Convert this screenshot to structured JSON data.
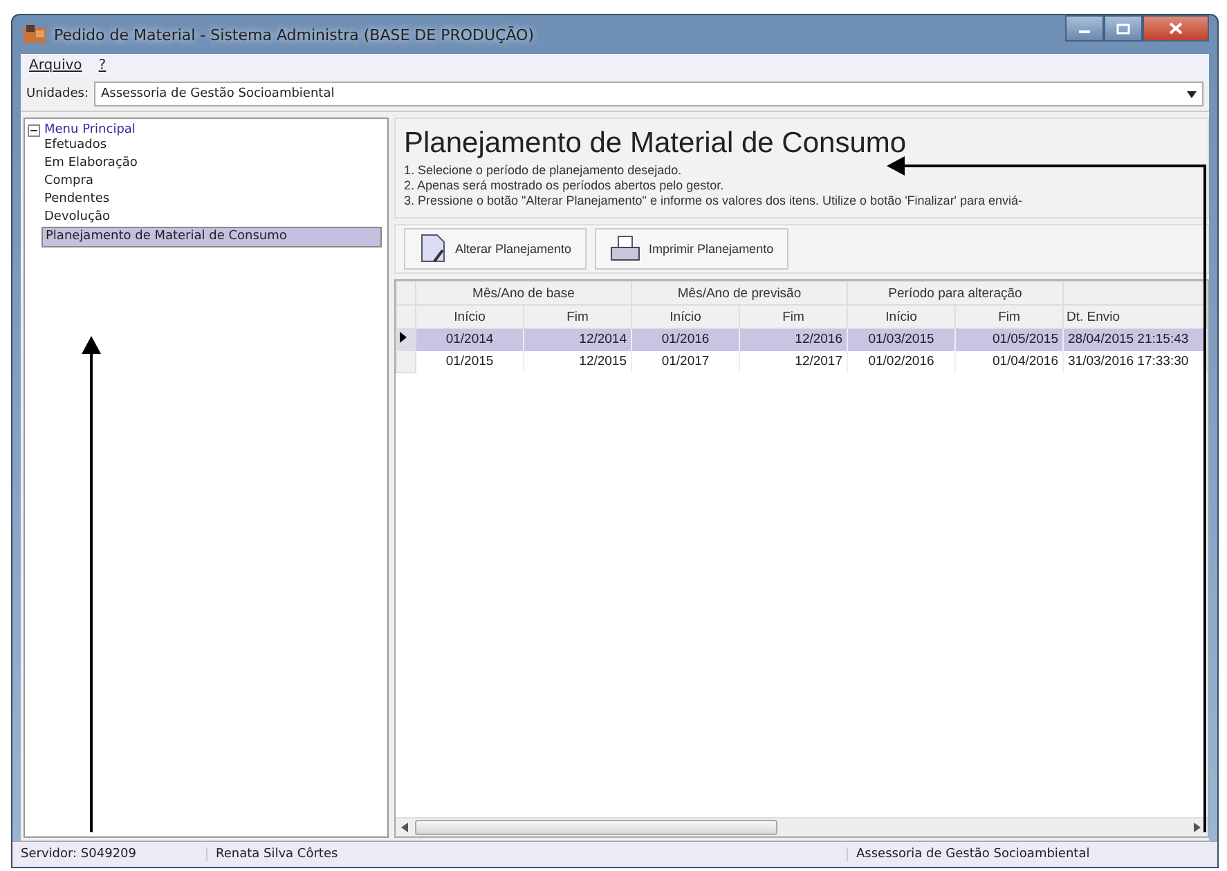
{
  "window": {
    "title": "Pedido de Material - Sistema Administra (BASE DE PRODUÇÃO)"
  },
  "menu": [
    "Arquivo",
    "?"
  ],
  "unit_selector": {
    "label": "Unidades:",
    "value": "Assessoria de Gestão Socioambiental"
  },
  "tree": {
    "label": "Menu Principal",
    "expanded": true,
    "children": [
      {
        "label": "Efetuados",
        "selected": false
      },
      {
        "label": "Em Elaboração",
        "selected": false
      },
      {
        "label": "Compra",
        "selected": false
      },
      {
        "label": "Pendentes",
        "selected": false
      },
      {
        "label": "Devolução",
        "selected": false
      },
      {
        "label": "Planejamento de Material de Consumo",
        "selected": true
      }
    ]
  },
  "page": {
    "heading": "Planejamento de Material de Consumo",
    "instructions": [
      "1. Selecione o período de planejamento desejado.",
      "2. Apenas será mostrado os períodos abertos pelo gestor.",
      "3. Pressione o botão \"Alterar Planejamento\" e informe os valores dos itens. Utilize o botão 'Finalizar' para enviá-"
    ]
  },
  "toolbar": [
    {
      "label": "Alterar Planejamento",
      "kind": "edit"
    },
    {
      "label": "Imprimir Planejamento",
      "kind": "print"
    }
  ],
  "table": {
    "column_groups": [
      "Mês/Ano de base",
      "Mês/Ano de previsão",
      "Período para alteração"
    ],
    "columns": [
      "Início",
      "Fim",
      "Início",
      "Fim",
      "Início",
      "Fim",
      "Dt. Envio"
    ],
    "rows": [
      {
        "selected": true,
        "cells": [
          "01/2014",
          "12/2014",
          "01/2016",
          "12/2016",
          "01/03/2015",
          "01/05/2015",
          "28/04/2015 21:15:43"
        ]
      },
      {
        "selected": false,
        "cells": [
          "01/2015",
          "12/2015",
          "01/2017",
          "12/2017",
          "01/02/2016",
          "01/04/2016",
          "31/03/2016 17:33:30"
        ]
      }
    ]
  },
  "status_bar": [
    "Servidor: S049209",
    "Renata Silva Côrtes",
    "Assessoria de Gestão Socioambiental"
  ]
}
